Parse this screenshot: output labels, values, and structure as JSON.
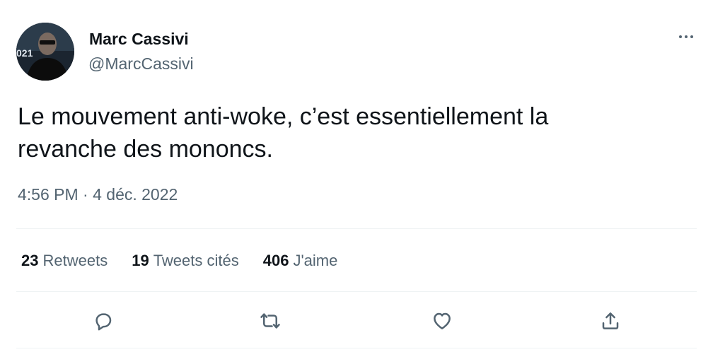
{
  "author": {
    "name": "Marc Cassivi",
    "handle": "@MarcCassivi",
    "avatar_caption": "021"
  },
  "tweet": {
    "text_line1": "Le mouvement anti-woke, c’est essentiellement la",
    "text_line2": "revanche des mononcs.",
    "timestamp": "4:56 PM · 4 déc. 2022"
  },
  "stats": {
    "retweets_count": "23",
    "retweets_label": "Retweets",
    "quotes_count": "19",
    "quotes_label": "Tweets cités",
    "likes_count": "406",
    "likes_label": "J'aime"
  },
  "icons": {
    "more": "more-horizontal-icon",
    "reply": "reply-icon",
    "retweet": "retweet-icon",
    "like": "heart-icon",
    "share": "share-icon"
  },
  "colors": {
    "text_primary": "#0f1419",
    "text_secondary": "#536471",
    "divider": "#eff3f4"
  }
}
